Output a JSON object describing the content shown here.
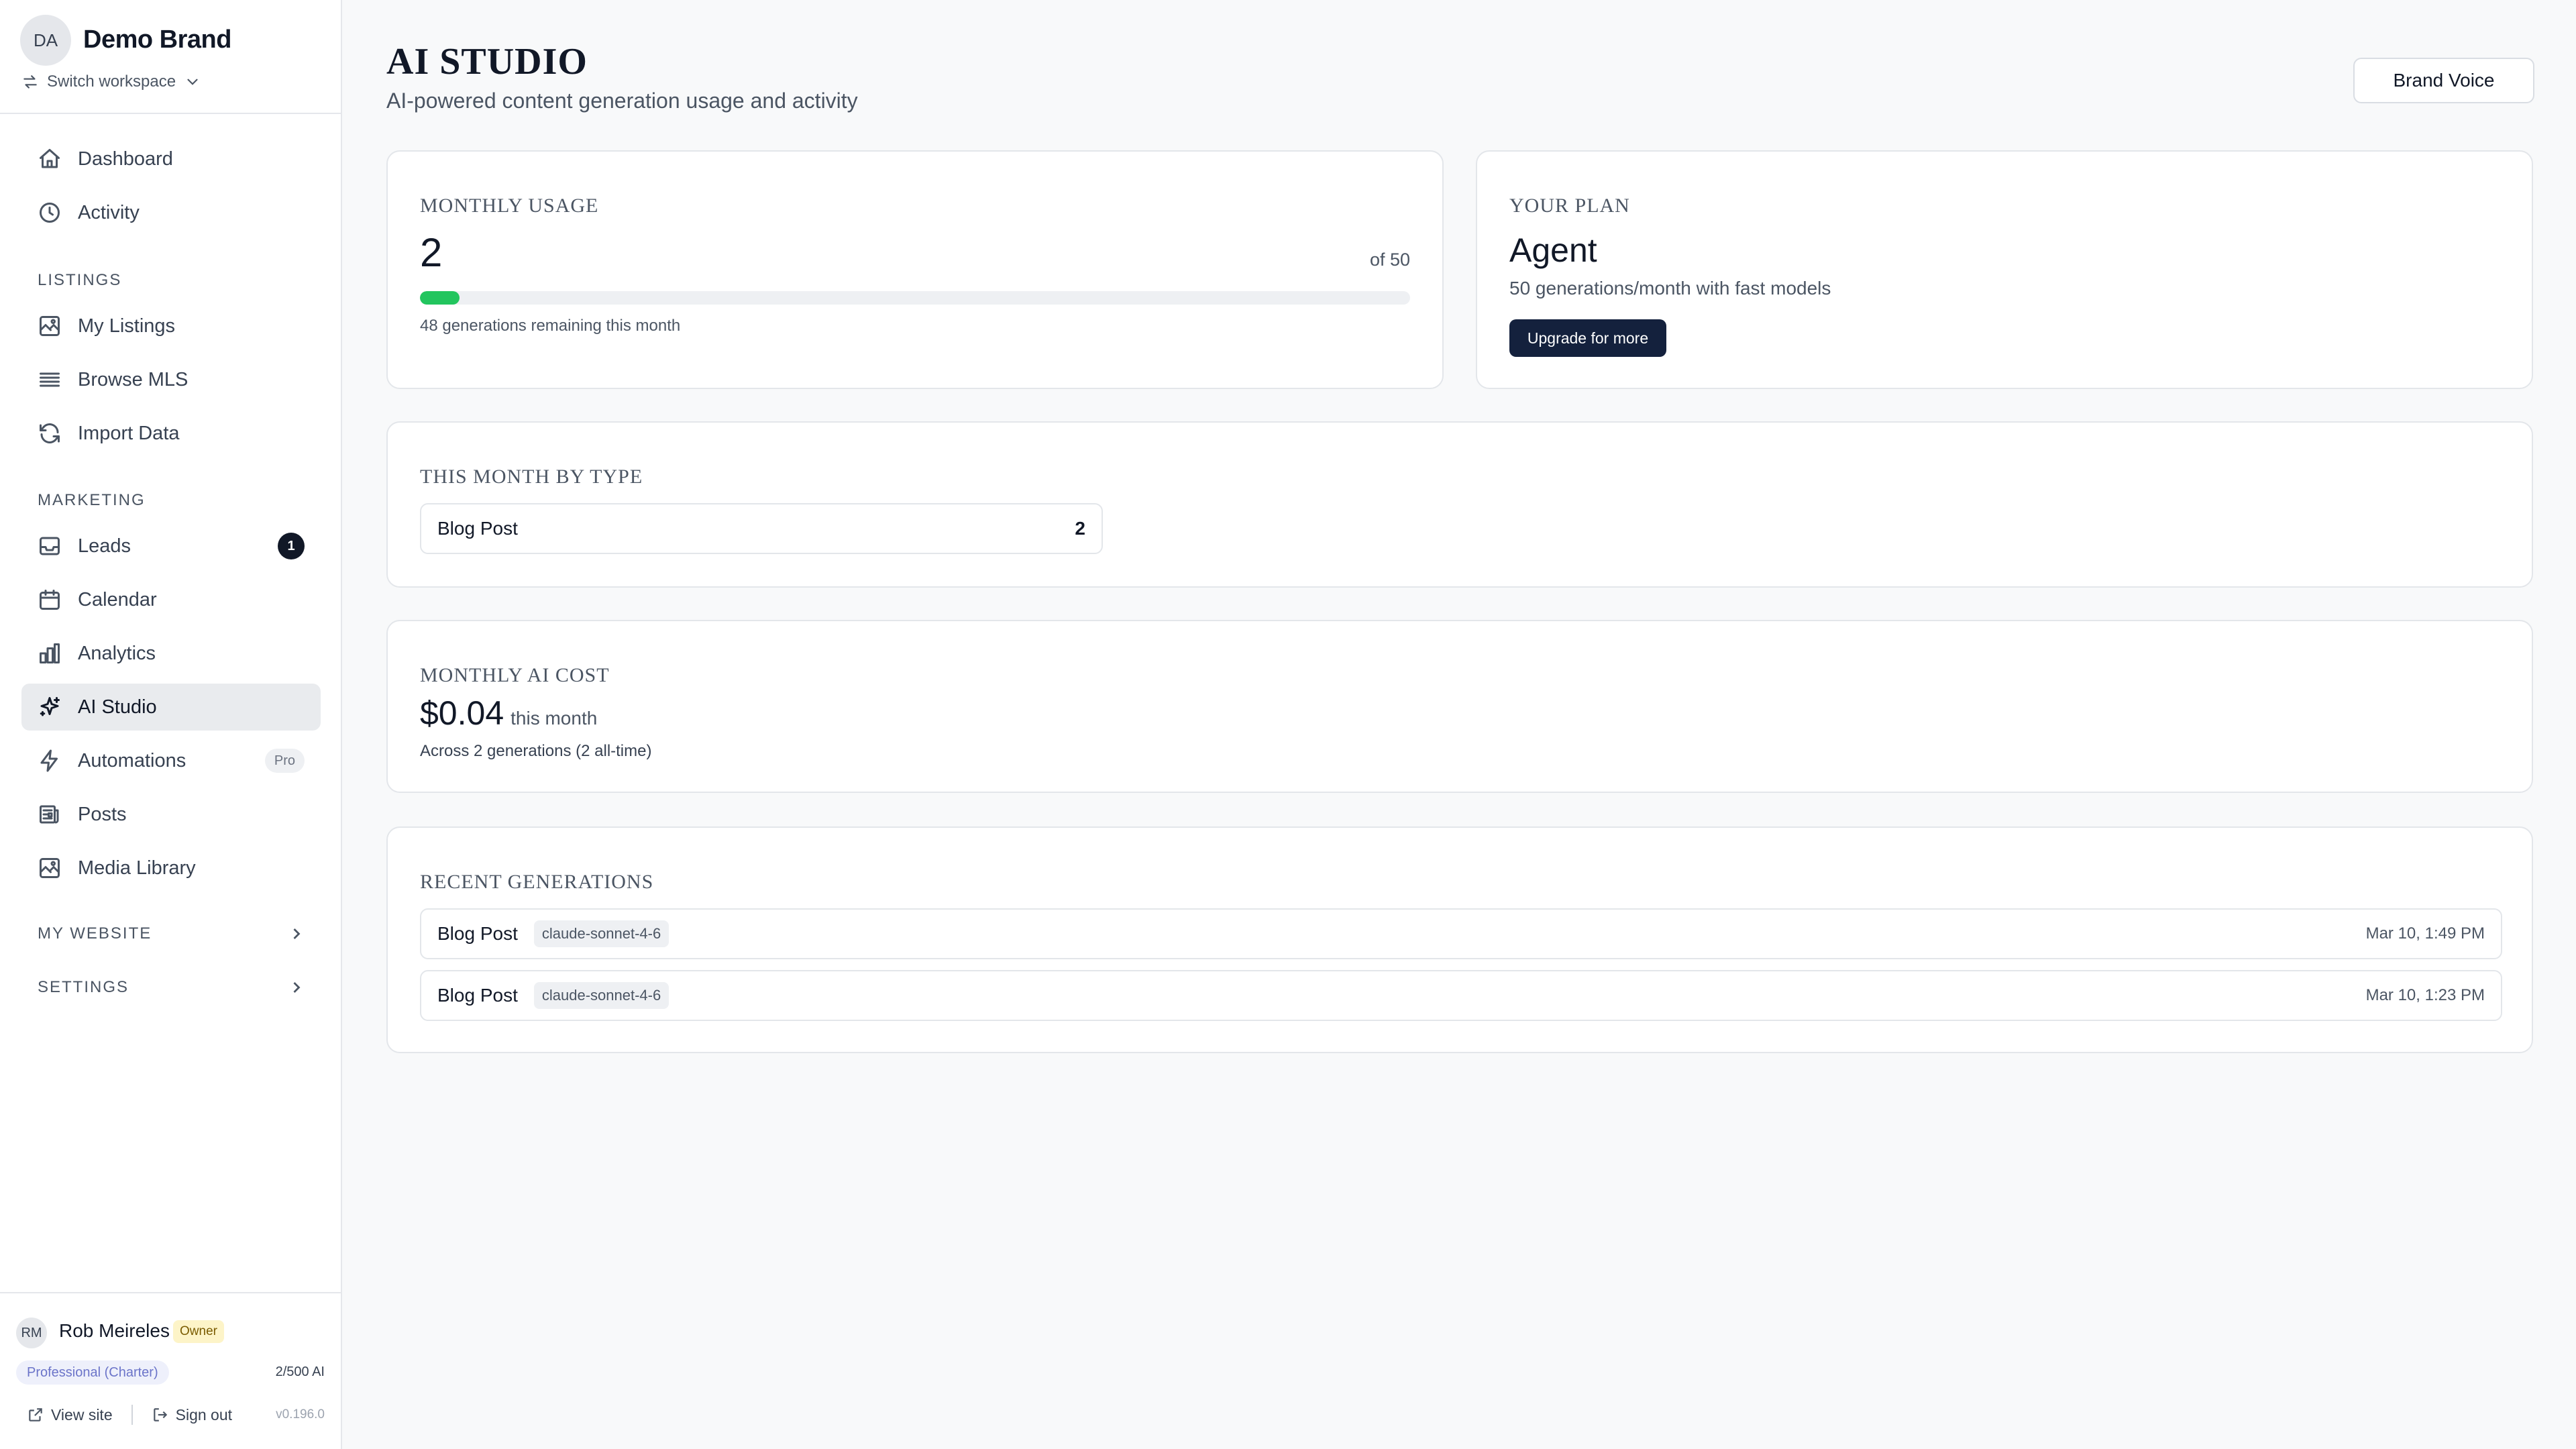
{
  "workspace": {
    "avatar_initials": "DA",
    "name": "Demo Brand",
    "switch_label": "Switch workspace",
    "switch_icon": "swap-icon",
    "switch_chevron": "chevron-down-icon"
  },
  "nav": {
    "top": [
      {
        "label": "Dashboard",
        "icon": "home-icon"
      },
      {
        "label": "Activity",
        "icon": "clock-icon"
      }
    ],
    "listings_header": "LISTINGS",
    "listings": [
      {
        "label": "My Listings",
        "icon": "image-icon"
      },
      {
        "label": "Browse MLS",
        "icon": "list-icon"
      },
      {
        "label": "Import Data",
        "icon": "refresh-icon"
      }
    ],
    "marketing_header": "MARKETING",
    "marketing": [
      {
        "label": "Leads",
        "icon": "inbox-icon",
        "badge": "1"
      },
      {
        "label": "Calendar",
        "icon": "calendar-icon"
      },
      {
        "label": "Analytics",
        "icon": "bar-chart-icon"
      },
      {
        "label": "AI Studio",
        "icon": "sparkles-icon",
        "active": true
      },
      {
        "label": "Automations",
        "icon": "lightning-icon",
        "tag": "Pro"
      },
      {
        "label": "Posts",
        "icon": "newspaper-icon"
      },
      {
        "label": "Media Library",
        "icon": "image-icon"
      }
    ],
    "my_website": "MY WEBSITE",
    "settings": "SETTINGS"
  },
  "user": {
    "initials": "RM",
    "name": "Rob Meireles",
    "role": "Owner",
    "plan": "Professional (Charter)",
    "ai_usage": "2/500 AI",
    "view_site": "View site",
    "sign_out": "Sign out",
    "version": "v0.196.0"
  },
  "header": {
    "title": "AI STUDIO",
    "subtitle": "AI-powered content generation usage and activity",
    "brand_voice": "Brand Voice"
  },
  "usage": {
    "title": "MONTHLY USAGE",
    "used": "2",
    "limit_label": "of 50",
    "progress_fraction": 0.04,
    "remaining": "48 generations remaining this month",
    "progress_color": "#22c55e"
  },
  "plan": {
    "title": "YOUR PLAN",
    "name": "Agent",
    "description": "50 generations/month with fast models",
    "upgrade": "Upgrade for more"
  },
  "by_type": {
    "title": "THIS MONTH BY TYPE",
    "rows": [
      {
        "label": "Blog Post",
        "count": "2"
      }
    ]
  },
  "cost": {
    "title": "MONTHLY AI COST",
    "amount": "$0.04",
    "suffix": "this month",
    "note": "Across 2 generations (2 all-time)"
  },
  "recent": {
    "title": "RECENT GENERATIONS",
    "rows": [
      {
        "type": "Blog Post",
        "model": "claude-sonnet-4-6",
        "time": "Mar 10, 1:49 PM"
      },
      {
        "type": "Blog Post",
        "model": "claude-sonnet-4-6",
        "time": "Mar 10, 1:23 PM"
      }
    ]
  }
}
